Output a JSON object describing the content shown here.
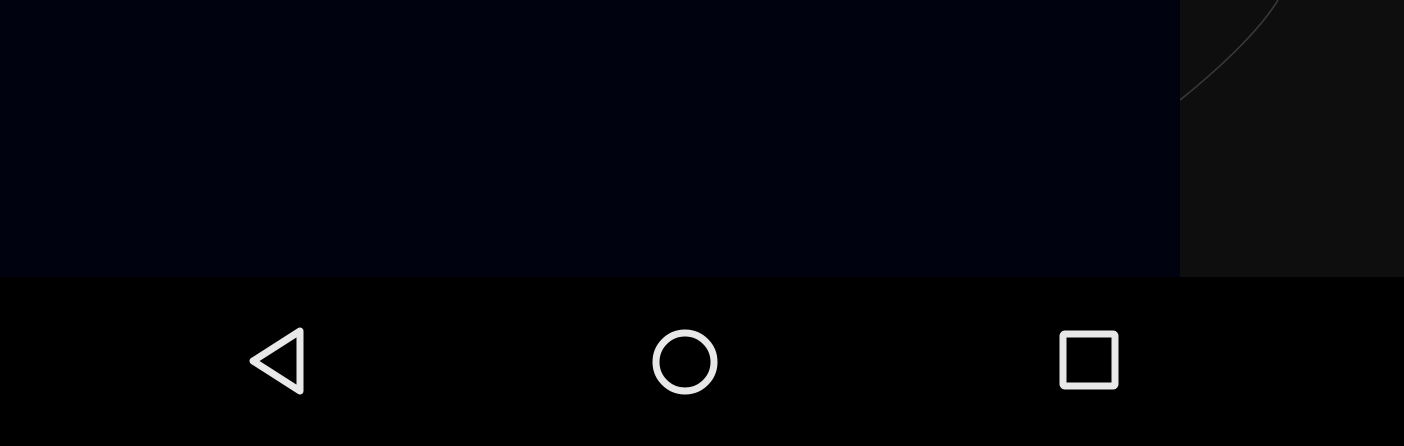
{
  "colors": {
    "main_background": "#00020f",
    "side_background": "#0e0e0e",
    "navigation_bar": "#000000",
    "nav_icon": "#e8e8e8",
    "side_curve": "#3a3a3a"
  },
  "navigation_bar": {
    "buttons": [
      {
        "id": "back",
        "icon": "back-triangle-icon"
      },
      {
        "id": "home",
        "icon": "home-circle-icon"
      },
      {
        "id": "recents",
        "icon": "recents-square-icon"
      }
    ]
  }
}
